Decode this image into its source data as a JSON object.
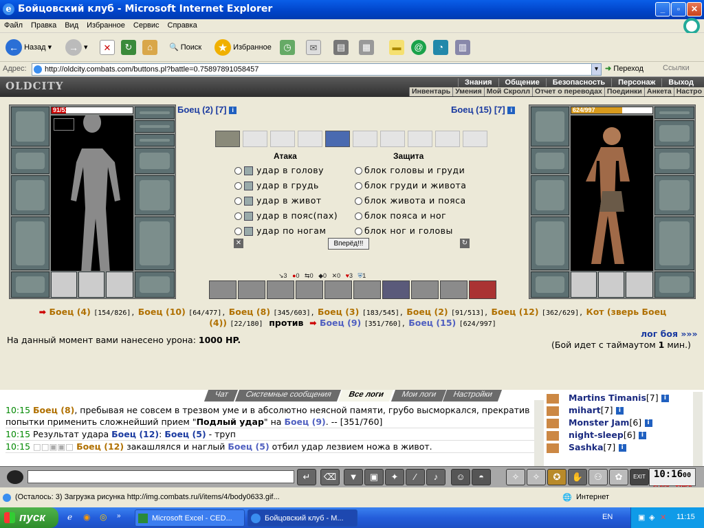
{
  "window": {
    "title": "Бойцовский клуб - Microsoft Internet Explorer",
    "min": "_",
    "max": "▫",
    "close": "✕"
  },
  "menu": [
    "Файл",
    "Правка",
    "Вид",
    "Избранное",
    "Сервис",
    "Справка"
  ],
  "toolbar": {
    "back": "Назад",
    "search": "Поиск",
    "favorites": "Избранное"
  },
  "address": {
    "label": "Адрес:",
    "url": "http://oldcity.combats.com/buttons.pl?battle=0.75897891058457",
    "go": "Переход",
    "links": "Ссылки"
  },
  "game": {
    "logo": "OLDCITY",
    "nav_top": [
      "Знания",
      "Общение",
      "Безопасность",
      "Персонаж",
      "Выход"
    ],
    "nav_sub": [
      "Инвентарь",
      "Умения",
      "Мой Скролл",
      "Отчет о переводах",
      "Поединки",
      "Анкета",
      "Настро"
    ],
    "left": {
      "hp": "91/513",
      "hp_fraction": 0.177,
      "name": "Боец (2) [7]"
    },
    "right": {
      "hp": "624/997",
      "hp_fraction": 0.626,
      "name": "Боец (15) [7]"
    },
    "info_icon": "i",
    "attack_header": "Атака",
    "defense_header": "Защита",
    "attacks": [
      "удар в голову",
      "удар в грудь",
      "удар в живот",
      "удар в пояс(пах)",
      "удар по ногам"
    ],
    "defenses": [
      "блок головы и груди",
      "блок груди и живота",
      "блок живота и пояса",
      "блок пояса и ног",
      "блок ног и головы"
    ],
    "forward": "Вперёд!!!",
    "stats": [
      "3",
      "0",
      "0",
      "0",
      "0",
      "3",
      "1"
    ],
    "combat": {
      "row1": [
        {
          "name": "Боец (4)",
          "hp": "[154/826],"
        },
        {
          "name": "Боец (10)",
          "hp": "[64/477],"
        },
        {
          "name": "Боец (8)",
          "hp": "[345/603],"
        },
        {
          "name": "Боец (3)",
          "hp": "[183/545],"
        },
        {
          "name": "Боец (2)",
          "hp": "[91/513],"
        },
        {
          "name": "Боец (12)",
          "hp": "[362/629],"
        },
        {
          "name": "Кот (зверь Боец",
          "hp": ""
        }
      ],
      "row2_ally": "(4))",
      "row2_ally_hp": "[22/180]",
      "vs": "против",
      "enemies": [
        {
          "name": "Боец (9)",
          "hp": "[351/760],"
        },
        {
          "name": "Боец (15)",
          "hp": "[624/997]"
        }
      ]
    },
    "damage_label": "На данный момент вами нанесено урона:",
    "damage_value": "1000 HP.",
    "log_link": "лог боя »»»",
    "timeout_pre": "(Бой идет с таймаутом",
    "timeout_num": "1",
    "timeout_post": "мин.)"
  },
  "chat": {
    "tabs": [
      "Чат",
      "Системные сообщения",
      "Все логи",
      "Мои логи",
      "Настройки"
    ],
    "lines": [
      {
        "time": "10:15",
        "a": "Боец (8)",
        "t1": ", пребывая не совсем в трезвом уме и в абсолютно неясной памяти, грубо высморкался, прекратив попытки применить сложнейший прием \"",
        "bold": "Подлый удар",
        "t2": "\" на ",
        "b": "Боец (9)",
        "t3": ". -- [351/760]"
      },
      {
        "time": "10:15",
        "t1": "Результат удара ",
        "b": "Боец (12)",
        "t2": ": ",
        "c": "Боец (5)",
        "t3": " - труп"
      },
      {
        "time": "10:15",
        "a": "Боец (12)",
        "t1": " закашлялся и наглый ",
        "c": "Боец (5)",
        "t2": " отбил удар лезвием ножа в живот."
      }
    ],
    "players": [
      {
        "name": "Martins Timanis",
        "lvl": "[7]"
      },
      {
        "name": "mihart",
        "lvl": "[7]"
      },
      {
        "name": "Monster Jam",
        "lvl": "[6]"
      },
      {
        "name": "night-sleep",
        "lvl": "[6]"
      },
      {
        "name": "Sashka",
        "lvl": "[7]"
      }
    ],
    "clock": "10:16",
    "clock_sec": "00",
    "clock_label": "CLOCK",
    "timer_label": "TIMER"
  },
  "status": {
    "text": "(Осталось: 3) Загрузка рисунка http://img.combats.ru/i/items/4/body0633.gif...",
    "zone": "Интернет"
  },
  "taskbar": {
    "start": "пуск",
    "tasks": [
      "Microsoft Excel - CED...",
      "Бойцовский клуб - М..."
    ],
    "lang": "EN",
    "time": "11:15"
  }
}
